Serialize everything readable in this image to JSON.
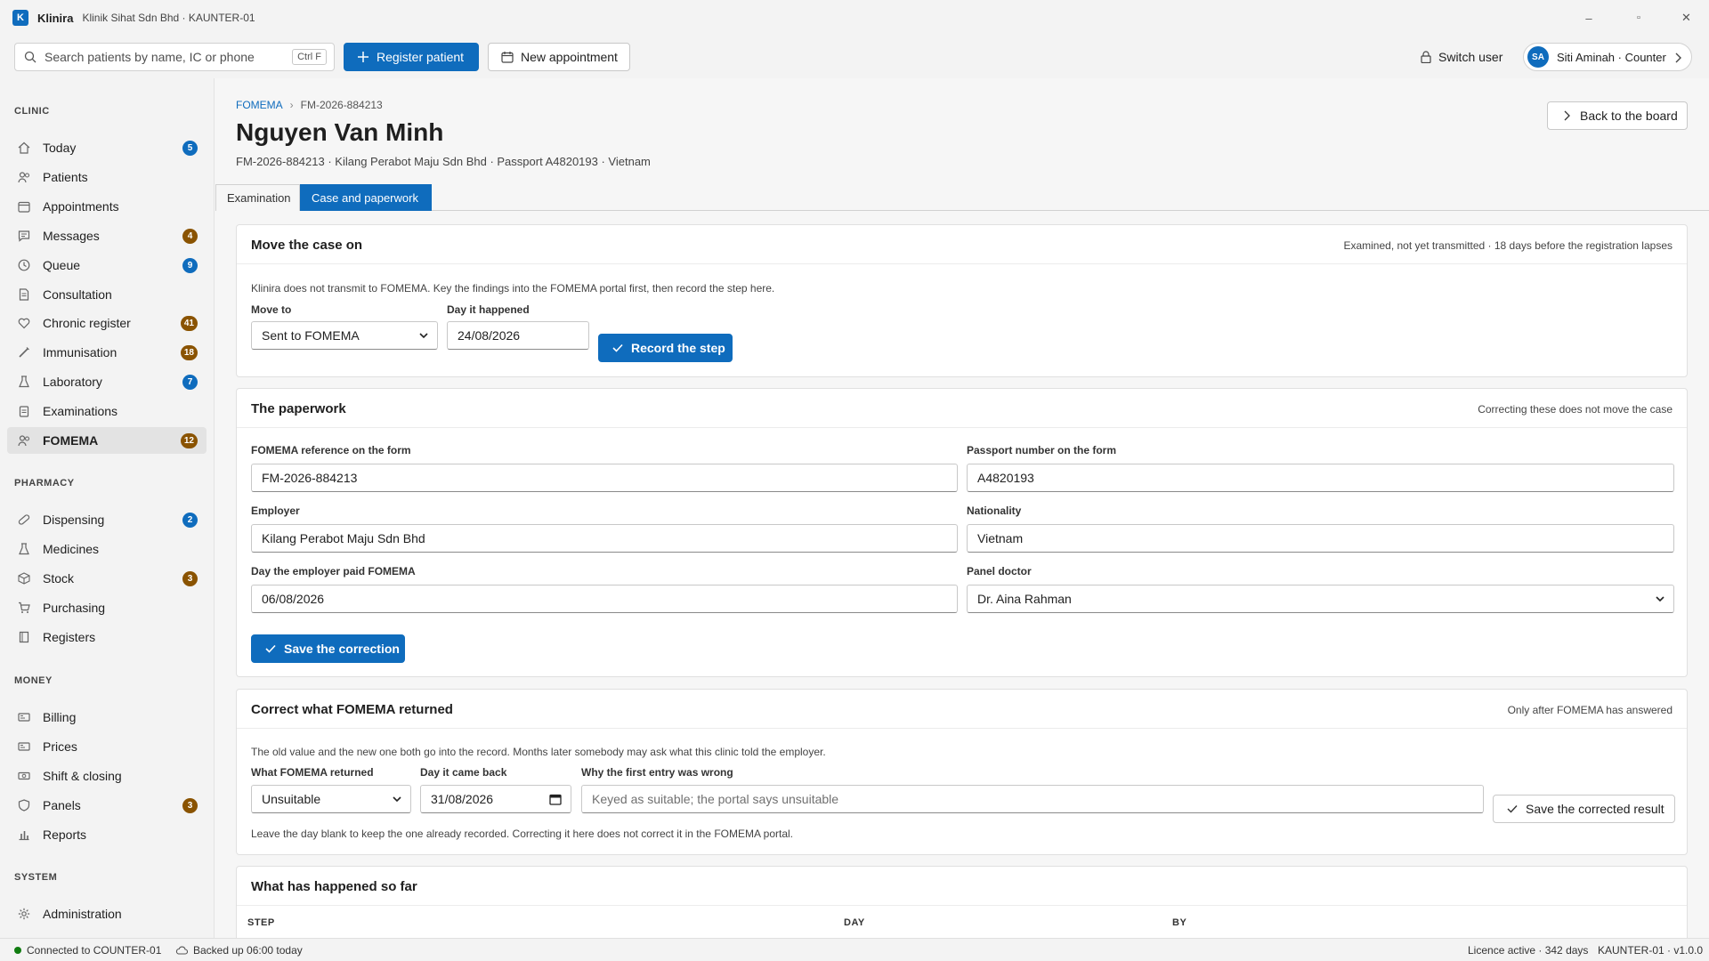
{
  "window": {
    "app_initial": "K",
    "app_name": "Klinira",
    "subtitle": "Klinik Sihat Sdn Bhd · KAUNTER-01",
    "minimize": "–",
    "maximize": "▫",
    "close": "✕"
  },
  "toolbar": {
    "search_placeholder": "Search patients by name, IC or phone",
    "search_shortcut": "Ctrl F",
    "register_label": "Register patient",
    "appointment_label": "New appointment",
    "switch_user_label": "Switch user",
    "user_initials": "SA",
    "user_label": "Siti Aminah · Counter"
  },
  "sidebar": {
    "clinic_title": "CLINIC",
    "clinic_items": [
      {
        "label": "Today",
        "badge": "5",
        "badge_color": "#0f6cbd",
        "icon": "home-icon"
      },
      {
        "label": "Patients",
        "badge": "",
        "icon": "people-icon"
      },
      {
        "label": "Appointments",
        "badge": "",
        "icon": "calendar-icon"
      },
      {
        "label": "Messages",
        "badge": "4",
        "badge_color": "#8a5300",
        "icon": "message-icon"
      },
      {
        "label": "Queue",
        "badge": "9",
        "badge_color": "#0f6cbd",
        "icon": "clock-icon"
      },
      {
        "label": "Consultation",
        "badge": "",
        "icon": "document-icon"
      },
      {
        "label": "Chronic register",
        "badge": "41",
        "badge_color": "#8a5300",
        "icon": "heart-icon"
      },
      {
        "label": "Immunisation",
        "badge": "18",
        "badge_color": "#8a5300",
        "icon": "syringe-icon"
      },
      {
        "label": "Laboratory",
        "badge": "7",
        "badge_color": "#0f6cbd",
        "icon": "flask-icon"
      },
      {
        "label": "Examinations",
        "badge": "",
        "icon": "clipboard-icon"
      },
      {
        "label": "FOMEMA",
        "badge": "12",
        "badge_color": "#8a5300",
        "icon": "people-icon",
        "active": true
      }
    ],
    "pharmacy_title": "PHARMACY",
    "pharmacy_items": [
      {
        "label": "Dispensing",
        "badge": "2",
        "badge_color": "#0f6cbd",
        "icon": "pill-icon"
      },
      {
        "label": "Medicines",
        "badge": "",
        "icon": "flask-icon"
      },
      {
        "label": "Stock",
        "badge": "3",
        "badge_color": "#8a5300",
        "icon": "box-icon"
      },
      {
        "label": "Purchasing",
        "badge": "",
        "icon": "cart-icon"
      },
      {
        "label": "Registers",
        "badge": "",
        "icon": "book-icon"
      }
    ],
    "money_title": "MONEY",
    "money_items": [
      {
        "label": "Billing",
        "badge": "",
        "icon": "money-icon"
      },
      {
        "label": "Prices",
        "badge": "",
        "icon": "money-icon"
      },
      {
        "label": "Shift & closing",
        "badge": "",
        "icon": "cash-icon"
      },
      {
        "label": "Panels",
        "badge": "3",
        "badge_color": "#8a5300",
        "icon": "shield-icon"
      },
      {
        "label": "Reports",
        "badge": "",
        "icon": "chart-icon"
      }
    ],
    "system_title": "SYSTEM",
    "system_items": [
      {
        "label": "Administration",
        "badge": "",
        "icon": "gear-icon"
      }
    ]
  },
  "page": {
    "breadcrumb_root": "FOMEMA",
    "breadcrumb_current": "FM-2026-884213",
    "title": "Nguyen Van Minh",
    "subtitle": "FM-2026-884213 · Kilang Perabot Maju Sdn Bhd · Passport A4820193 · Vietnam",
    "back_label": "Back to the board",
    "tabs": [
      "Examination",
      "Case and paperwork"
    ]
  },
  "move_case": {
    "title": "Move the case on",
    "meta": "Examined, not yet transmitted · 18 days before the registration lapses",
    "note": "Klinira does not transmit to FOMEMA. Key the findings into the FOMEMA portal first, then record the step here.",
    "move_to_label": "Move to",
    "move_to_value": "Sent to FOMEMA",
    "day_label": "Day it happened",
    "day_value": "24/08/2026",
    "record_label": "Record the step"
  },
  "paperwork": {
    "title": "The paperwork",
    "meta": "Correcting these does not move the case",
    "ref_label": "FOMEMA reference on the form",
    "ref_value": "FM-2026-884213",
    "passport_label": "Passport number on the form",
    "passport_value": "A4820193",
    "employer_label": "Employer",
    "employer_value": "Kilang Perabot Maju Sdn Bhd",
    "nationality_label": "Nationality",
    "nationality_value": "Vietnam",
    "paid_label": "Day the employer paid FOMEMA",
    "paid_value": "06/08/2026",
    "doctor_label": "Panel doctor",
    "doctor_value": "Dr. Aina Rahman",
    "save_label": "Save the correction"
  },
  "correct_result": {
    "title": "Correct what FOMEMA returned",
    "meta": "Only after FOMEMA has answered",
    "note": "The old value and the new one both go into the record. Months later somebody may ask what this clinic told the employer.",
    "returned_label": "What FOMEMA returned",
    "returned_value": "Unsuitable",
    "came_back_label": "Day it came back",
    "came_back_value": "31/08/2026",
    "why_label": "Why the first entry was wrong",
    "why_placeholder": "Keyed as suitable; the portal says unsuitable",
    "save_label": "Save the corrected result",
    "footnote": "Leave the day blank to keep the one already recorded. Correcting it here does not correct it in the FOMEMA portal."
  },
  "history": {
    "title": "What has happened so far",
    "columns": [
      "STEP",
      "DAY",
      "BY"
    ]
  },
  "statusbar": {
    "connection": "Connected to COUNTER-01",
    "backup": "Backed up 06:00 today",
    "licence": "Licence active · 342 days",
    "version": "KAUNTER-01 · v1.0.0"
  },
  "colors": {
    "accent": "#0f6cbd",
    "badge_warning": "#8a5300",
    "connected": "#107c10"
  }
}
